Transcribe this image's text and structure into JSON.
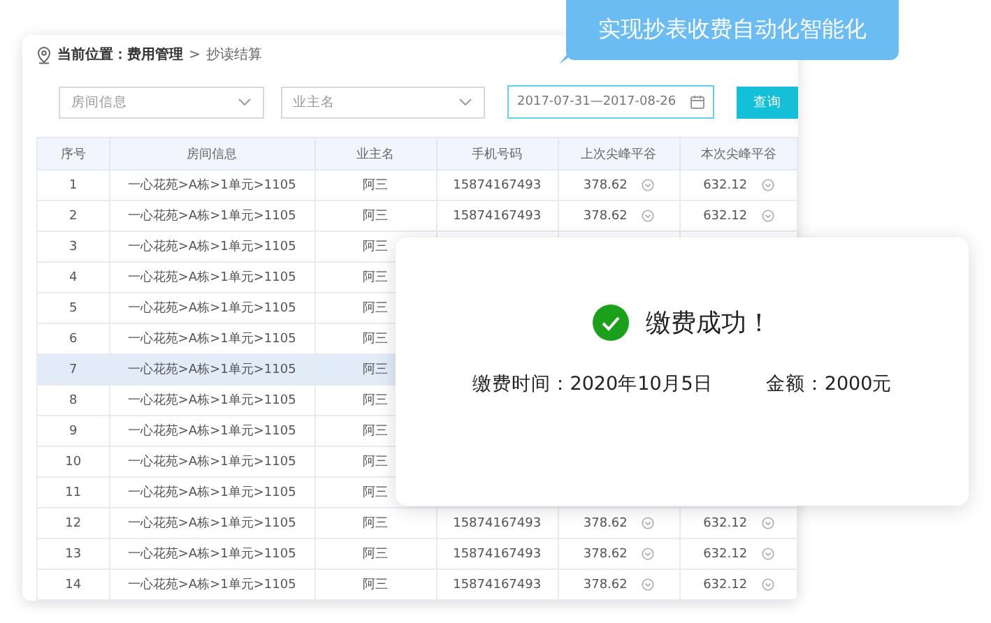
{
  "banner": {
    "text": "实现抄表收费自动化智能化"
  },
  "breadcrumb": {
    "label": "当前位置：费用管理",
    "separator": ">",
    "current": "抄读结算"
  },
  "filters": {
    "room": {
      "placeholder": "房间信息"
    },
    "owner": {
      "placeholder": "业主名"
    },
    "date": {
      "value": "2017-07-31—2017-08-26"
    },
    "search_button": "查询"
  },
  "table": {
    "columns": [
      "序号",
      "房间信息",
      "业主名",
      "手机号码",
      "上次尖峰平谷",
      "本次尖峰平谷"
    ],
    "rows": [
      {
        "no": "1",
        "room": "一心花苑>A栋>1单元>1105",
        "owner": "阿三",
        "phone": "15874167493",
        "prev": "378.62",
        "curr": "632.12",
        "selected": false
      },
      {
        "no": "2",
        "room": "一心花苑>A栋>1单元>1105",
        "owner": "阿三",
        "phone": "15874167493",
        "prev": "378.62",
        "curr": "632.12",
        "selected": false
      },
      {
        "no": "3",
        "room": "一心花苑>A栋>1单元>1105",
        "owner": "阿三",
        "selected": false
      },
      {
        "no": "4",
        "room": "一心花苑>A栋>1单元>1105",
        "owner": "阿三",
        "selected": false
      },
      {
        "no": "5",
        "room": "一心花苑>A栋>1单元>1105",
        "owner": "阿三",
        "selected": false
      },
      {
        "no": "6",
        "room": "一心花苑>A栋>1单元>1105",
        "owner": "阿三",
        "selected": false
      },
      {
        "no": "7",
        "room": "一心花苑>A栋>1单元>1105",
        "owner": "阿三",
        "selected": true
      },
      {
        "no": "8",
        "room": "一心花苑>A栋>1单元>1105",
        "owner": "阿三",
        "selected": false
      },
      {
        "no": "9",
        "room": "一心花苑>A栋>1单元>1105",
        "owner": "阿三",
        "selected": false
      },
      {
        "no": "10",
        "room": "一心花苑>A栋>1单元>1105",
        "owner": "阿三",
        "selected": false
      },
      {
        "no": "11",
        "room": "一心花苑>A栋>1单元>1105",
        "owner": "阿三",
        "selected": false
      },
      {
        "no": "12",
        "room": "一心花苑>A栋>1单元>1105",
        "owner": "阿三",
        "phone": "15874167493",
        "prev": "378.62",
        "curr": "632.12",
        "selected": false
      },
      {
        "no": "13",
        "room": "一心花苑>A栋>1单元>1105",
        "owner": "阿三",
        "phone": "15874167493",
        "prev": "378.62",
        "curr": "632.12",
        "selected": false
      },
      {
        "no": "14",
        "room": "一心花苑>A栋>1单元>1105",
        "owner": "阿三",
        "phone": "15874167493",
        "prev": "378.62",
        "curr": "632.12",
        "selected": false
      }
    ]
  },
  "dialog": {
    "title": "缴费成功！",
    "time": "缴费时间：2020年10月5日",
    "amount": "金额：2000元"
  }
}
